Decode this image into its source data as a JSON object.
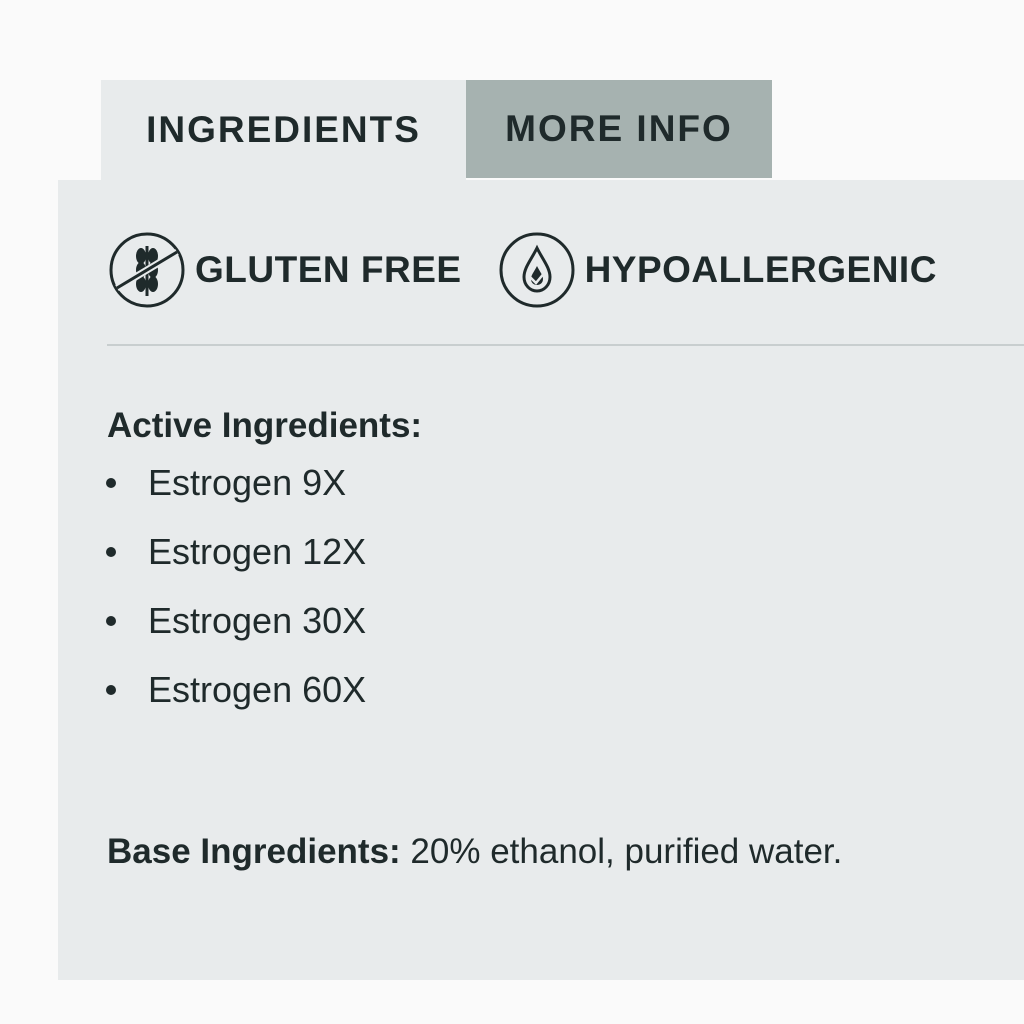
{
  "tabs": [
    {
      "label": "INGREDIENTS",
      "active": true
    },
    {
      "label": "MORE INFO",
      "active": false
    }
  ],
  "badges": [
    {
      "icon": "gluten-free-icon",
      "label": "GLUTEN FREE"
    },
    {
      "icon": "hypoallergenic-icon",
      "label": "HYPOALLERGENIC"
    }
  ],
  "active_ingredients": {
    "title": "Active Ingredients:",
    "items": [
      "Estrogen 9X",
      "Estrogen 12X",
      "Estrogen 30X",
      "Estrogen 60X"
    ]
  },
  "base_ingredients": {
    "label": "Base Ingredients:",
    "value": " 20% ethanol, purified water."
  },
  "colors": {
    "panel_bg": "#e8ebec",
    "inactive_tab_bg": "#a6b2b0",
    "text": "#1f2a2b"
  }
}
